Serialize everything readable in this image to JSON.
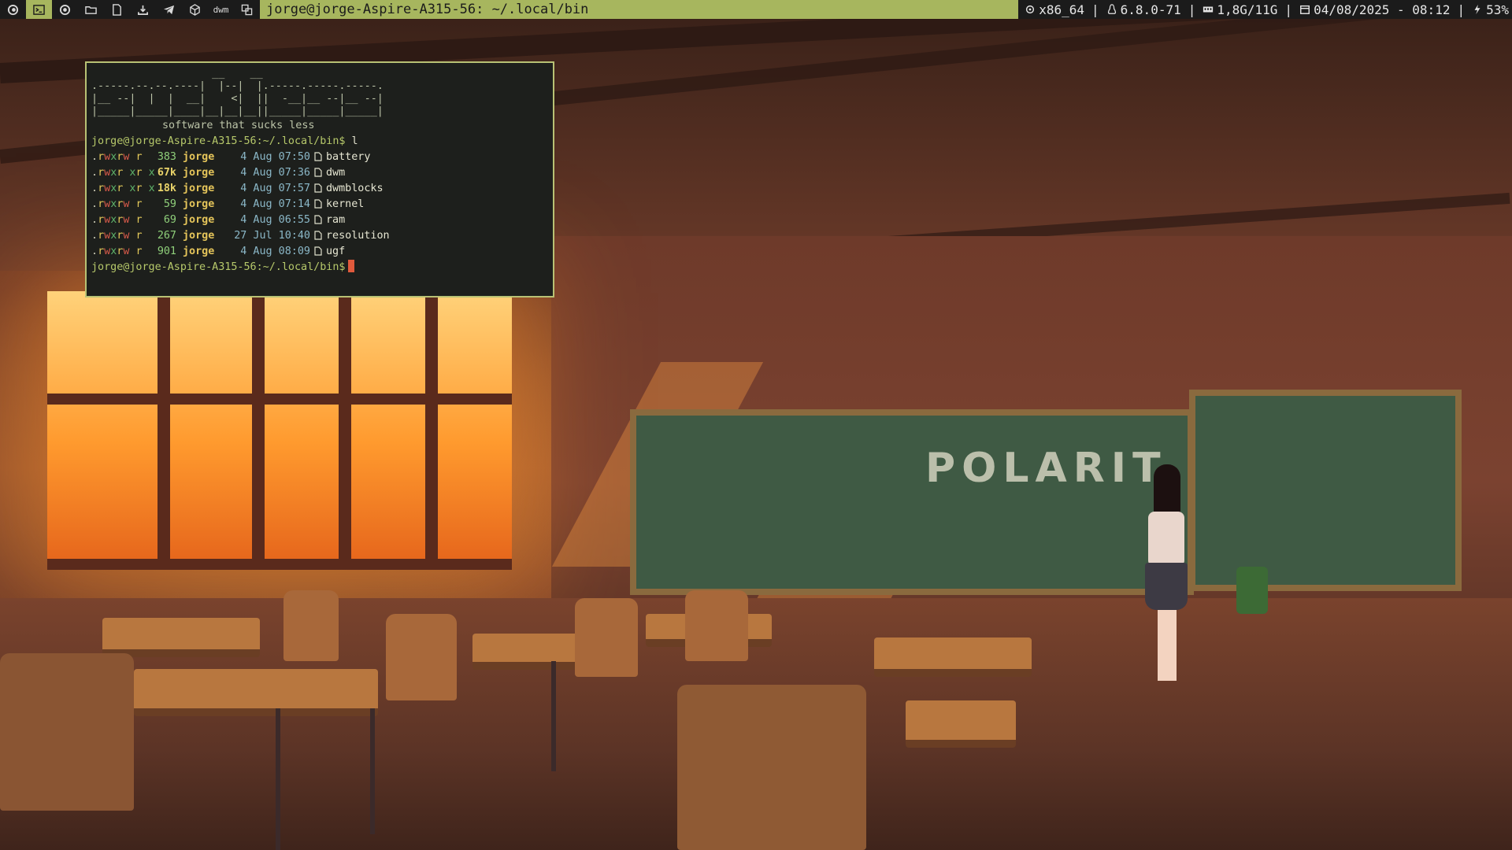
{
  "bar": {
    "tags": [
      {
        "name": "tag-logo",
        "icon": "debian-swirl-icon"
      },
      {
        "name": "tag-terminal",
        "icon": "terminal-icon",
        "active": true
      },
      {
        "name": "tag-browser",
        "icon": "browser-icon"
      },
      {
        "name": "tag-files",
        "icon": "folder-icon"
      },
      {
        "name": "tag-document",
        "icon": "document-icon"
      },
      {
        "name": "tag-download",
        "icon": "download-icon"
      },
      {
        "name": "tag-telegram",
        "icon": "telegram-icon"
      },
      {
        "name": "tag-settings",
        "icon": "cube-icon"
      },
      {
        "name": "tag-dwm",
        "label": "dwm"
      },
      {
        "name": "tag-windows",
        "icon": "windows-icon"
      }
    ],
    "window_title": "jorge@jorge-Aspire-A315-56: ~/.local/bin",
    "status": {
      "arch": "x86_64",
      "kernel": "6.8.0-71",
      "ram": "1,8G/11G",
      "datetime": "04/08/2025 - 08:12",
      "battery": "53%"
    },
    "colors": {
      "accent": "#a7b65e",
      "background": "#1b1b1b"
    }
  },
  "terminal": {
    "ascii_art": "                   __    __\n.-----.--.--.----|  |--|  |.-----.-----.-----.\n|__ --|  |  |  __|    <|  ||  -__|__ --|__ --|\n|_____|_____|____|__|__|__||_____|_____|_____|",
    "tagline": "software that sucks less",
    "prompt": "jorge@jorge-Aspire-A315-56:~/.local/bin$",
    "command": "l",
    "files": [
      {
        "perms": ".rwxrw r  ",
        "size": "383",
        "user": "jorge",
        "date": " 4 Aug 07:50",
        "name": "battery"
      },
      {
        "perms": ".rwxr xr x",
        "size": "67k",
        "user": "jorge",
        "date": " 4 Aug 07:36",
        "name": "dwm"
      },
      {
        "perms": ".rwxr xr x",
        "size": "18k",
        "user": "jorge",
        "date": " 4 Aug 07:57",
        "name": "dwmblocks"
      },
      {
        "perms": ".rwxrw r  ",
        "size": "59",
        "user": "jorge",
        "date": " 4 Aug 07:14",
        "name": "kernel"
      },
      {
        "perms": ".rwxrw r  ",
        "size": "69",
        "user": "jorge",
        "date": " 4 Aug 06:55",
        "name": "ram"
      },
      {
        "perms": ".rwxrw r  ",
        "size": "267",
        "user": "jorge",
        "date": "27 Jul 10:40",
        "name": "resolution"
      },
      {
        "perms": ".rwxrw r  ",
        "size": "901",
        "user": "jorge",
        "date": " 4 Aug 08:09",
        "name": "ugf"
      }
    ],
    "final_prompt": "jorge@jorge-Aspire-A315-56:~/.local/bin$"
  },
  "wallpaper": {
    "chalkboard_text": "POLARIT",
    "colors": {
      "window_glow": "#ff9a2e",
      "chalkboard": "#3f5a44",
      "wall": "#7b4230"
    }
  }
}
